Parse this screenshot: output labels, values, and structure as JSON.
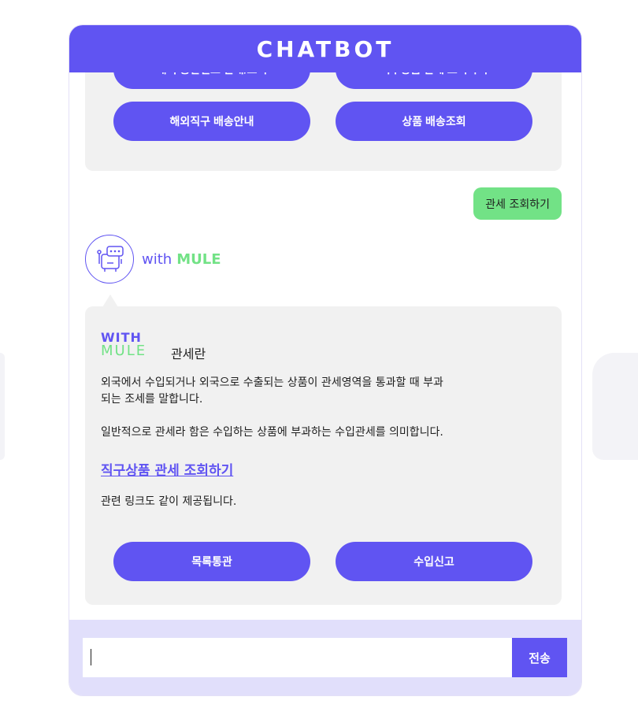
{
  "header": {
    "title": "CHATBOT"
  },
  "menu": {
    "buttons": [
      {
        "label": "해외 통관번호 안내/조회"
      },
      {
        "label": "직구상품 관세 조회하기"
      },
      {
        "label": "해외직구 배송안내"
      },
      {
        "label": "상품 배송조회"
      }
    ]
  },
  "user_message": {
    "text": "관세 조회하기"
  },
  "bot": {
    "name_prefix": "with",
    "name_brand": "MULE"
  },
  "reply": {
    "logo": {
      "line1": "WITH",
      "line2": "MULE"
    },
    "title": "관세란",
    "paragraph1": "외국에서 수입되거나 외국으로 수출되는 상품이 관세영역을 통과할 때 부과되는 조세를 말합니다.",
    "paragraph2": "일반적으로 관세라 함은 수입하는 상품에 부과하는 수입관세를 의미합니다.",
    "link": "직구상품 관세 조회하기",
    "paragraph3": "관련 링크도 같이 제공됩니다.",
    "buttons": [
      {
        "label": "목록통관"
      },
      {
        "label": "수입신고"
      }
    ]
  },
  "input": {
    "value": "",
    "placeholder": ""
  },
  "send_button": {
    "label": "전송"
  },
  "colors": {
    "primary": "#6054f2",
    "accent_green": "#72e286",
    "card_bg": "#f1f1f1",
    "input_bar_bg": "#e1dffb"
  }
}
